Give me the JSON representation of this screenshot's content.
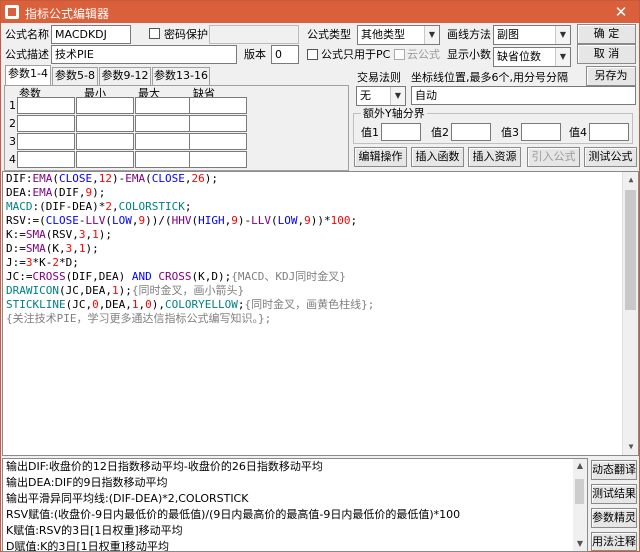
{
  "window": {
    "title": "指标公式编辑器",
    "close_symbol": "✕"
  },
  "form": {
    "name_label": "公式名称",
    "name_value": "MACDKDJ",
    "password_label": "密码保护",
    "desc_label": "公式描述",
    "desc_value": "技术PIE",
    "version_label": "版本",
    "version_value": "0",
    "type_label": "公式类型",
    "type_value": "其他类型",
    "draw_label": "画线方法",
    "draw_value": "副图",
    "pc_only_label": "公式只用于PC",
    "cloud_label": "云公式",
    "decimals_label": "显示小数",
    "decimals_value": "缺省位数",
    "trade_rule_label": "交易法则",
    "trade_rule_value": "无",
    "coord_label": "坐标线位置,最多6个,用分号分隔",
    "coord_value": "自动",
    "extra_axis_title": "额外Y轴分界",
    "value_labels": [
      "值1",
      "值2",
      "值3",
      "值4"
    ]
  },
  "buttons": {
    "ok": "确 定",
    "cancel": "取 消",
    "save_as": "另存为",
    "edit_op": "编辑操作",
    "insert_func": "插入函数",
    "insert_res": "插入资源",
    "import_formula": "引入公式",
    "test_formula": "测试公式",
    "dynamic_translate": "动态翻译",
    "test_result": "测试结果",
    "param_wizard": "参数精灵",
    "usage_notes": "用法注释"
  },
  "tabs": [
    "参数1-4",
    "参数5-8",
    "参数9-12",
    "参数13-16"
  ],
  "params": {
    "headers": [
      "参数",
      "最小",
      "最大",
      "缺省"
    ],
    "rows": [
      "1",
      "2",
      "3",
      "4"
    ]
  },
  "colors": {
    "titlebar": "#d9603b",
    "keyword": "#0000ff",
    "function": "#800080",
    "number": "#ff0000",
    "comment": "#808080",
    "draw_keyword": "#008080",
    "text": "#000000"
  },
  "code": [
    [
      [
        "t",
        "DIF:"
      ],
      [
        "f",
        "EMA"
      ],
      [
        "t",
        "("
      ],
      [
        "k",
        "CLOSE"
      ],
      [
        "t",
        ","
      ],
      [
        "n",
        "12"
      ],
      [
        "t",
        ")-"
      ],
      [
        "f",
        "EMA"
      ],
      [
        "t",
        "("
      ],
      [
        "k",
        "CLOSE"
      ],
      [
        "t",
        ","
      ],
      [
        "n",
        "26"
      ],
      [
        "t",
        ");"
      ]
    ],
    [
      [
        "t",
        "DEA:"
      ],
      [
        "f",
        "EMA"
      ],
      [
        "t",
        "(DIF,"
      ],
      [
        "n",
        "9"
      ],
      [
        "t",
        ");"
      ]
    ],
    [
      [
        "d",
        "MACD"
      ],
      [
        "t",
        ":(DIF-DEA)*"
      ],
      [
        "n",
        "2"
      ],
      [
        "t",
        ","
      ],
      [
        "d",
        "COLORSTICK"
      ],
      [
        "t",
        ";"
      ]
    ],
    [
      [
        "t",
        "RSV:=("
      ],
      [
        "k",
        "CLOSE"
      ],
      [
        "t",
        "-"
      ],
      [
        "f",
        "LLV"
      ],
      [
        "t",
        "("
      ],
      [
        "k",
        "LOW"
      ],
      [
        "t",
        ","
      ],
      [
        "n",
        "9"
      ],
      [
        "t",
        "))/("
      ],
      [
        "f",
        "HHV"
      ],
      [
        "t",
        "("
      ],
      [
        "k",
        "HIGH"
      ],
      [
        "t",
        ","
      ],
      [
        "n",
        "9"
      ],
      [
        "t",
        ")-"
      ],
      [
        "f",
        "LLV"
      ],
      [
        "t",
        "("
      ],
      [
        "k",
        "LOW"
      ],
      [
        "t",
        ","
      ],
      [
        "n",
        "9"
      ],
      [
        "t",
        "))*"
      ],
      [
        "n",
        "100"
      ],
      [
        "t",
        ";"
      ]
    ],
    [
      [
        "t",
        "K:="
      ],
      [
        "f",
        "SMA"
      ],
      [
        "t",
        "(RSV,"
      ],
      [
        "n",
        "3"
      ],
      [
        "t",
        ","
      ],
      [
        "n",
        "1"
      ],
      [
        "t",
        ");"
      ]
    ],
    [
      [
        "t",
        "D:="
      ],
      [
        "f",
        "SMA"
      ],
      [
        "t",
        "(K,"
      ],
      [
        "n",
        "3"
      ],
      [
        "t",
        ","
      ],
      [
        "n",
        "1"
      ],
      [
        "t",
        ");"
      ]
    ],
    [
      [
        "t",
        "J:="
      ],
      [
        "n",
        "3"
      ],
      [
        "t",
        "*K-"
      ],
      [
        "n",
        "2"
      ],
      [
        "t",
        "*D;"
      ]
    ],
    [
      [
        "t",
        "JC:="
      ],
      [
        "f",
        "CROSS"
      ],
      [
        "t",
        "(DIF,DEA) "
      ],
      [
        "k",
        "AND"
      ],
      [
        "t",
        " "
      ],
      [
        "f",
        "CROSS"
      ],
      [
        "t",
        "(K,D);"
      ],
      [
        "c",
        "{MACD、KDJ同时金叉}"
      ]
    ],
    [
      [
        "d",
        "DRAWICON"
      ],
      [
        "t",
        "(JC,DEA,"
      ],
      [
        "n",
        "1"
      ],
      [
        "t",
        ");"
      ],
      [
        "c",
        "{同时金叉，画小箭头}"
      ]
    ],
    [
      [
        "d",
        "STICKLINE"
      ],
      [
        "t",
        "(JC,"
      ],
      [
        "n",
        "0"
      ],
      [
        "t",
        ",DEA,"
      ],
      [
        "n",
        "1"
      ],
      [
        "t",
        ","
      ],
      [
        "n",
        "0"
      ],
      [
        "t",
        "),"
      ],
      [
        "d",
        "COLORYELLOW"
      ],
      [
        "t",
        ";"
      ],
      [
        "c",
        "{同时金叉，画黄色柱线};"
      ]
    ],
    [
      [
        "c",
        "{关注技术PIE，学习更多通达信指标公式编写知识。};"
      ]
    ]
  ],
  "output_lines": [
    "输出DIF:收盘价的12日指数移动平均-收盘价的26日指数移动平均",
    "输出DEA:DIF的9日指数移动平均",
    "输出平滑异同平均线:(DIF-DEA)*2,COLORSTICK",
    "RSV赋值:(收盘价-9日内最低价的最低值)/(9日内最高价的最高值-9日内最低价的最低值)*100",
    "K赋值:RSV的3日[1日权重]移动平均",
    "D赋值:K的3日[1日权重]移动平均"
  ]
}
